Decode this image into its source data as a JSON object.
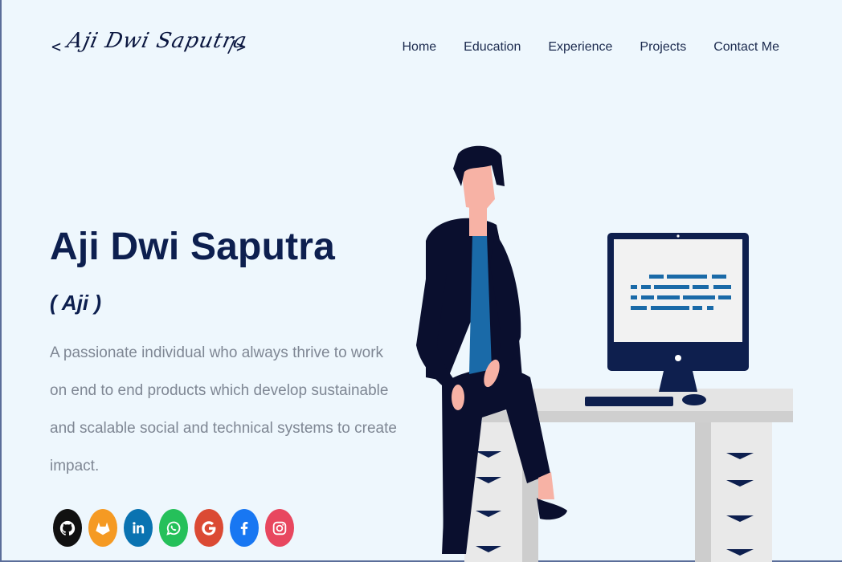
{
  "header": {
    "logo": {
      "left_bracket": "<",
      "signature": "Aji Dwi Saputra",
      "right_bracket": "/>"
    },
    "nav": [
      "Home",
      "Education",
      "Experience",
      "Projects",
      "Contact Me"
    ]
  },
  "hero": {
    "name": "Aji Dwi Saputra",
    "nickname": "( Aji )",
    "bio": "A passionate individual who always thrive to work on end to end products which develop sustainable and scalable social and technical systems to create impact."
  },
  "socials": [
    {
      "name": "github",
      "icon": "github-icon",
      "color": "#111111"
    },
    {
      "name": "gitlab",
      "icon": "gitlab-icon",
      "color": "#f59a23"
    },
    {
      "name": "linkedin",
      "icon": "linkedin-icon",
      "color": "#0a73b1"
    },
    {
      "name": "whatsapp",
      "icon": "whatsapp-icon",
      "color": "#25c05a"
    },
    {
      "name": "google",
      "icon": "google-icon",
      "color": "#db4a34"
    },
    {
      "name": "facebook",
      "icon": "facebook-icon",
      "color": "#1877f2"
    },
    {
      "name": "instagram",
      "icon": "instagram-icon",
      "color": "#e8475f"
    }
  ],
  "colors": {
    "background": "#eef7fd",
    "heading": "#0d1f4f",
    "text_muted": "#7f8794",
    "accent": "#1a6aa8"
  }
}
